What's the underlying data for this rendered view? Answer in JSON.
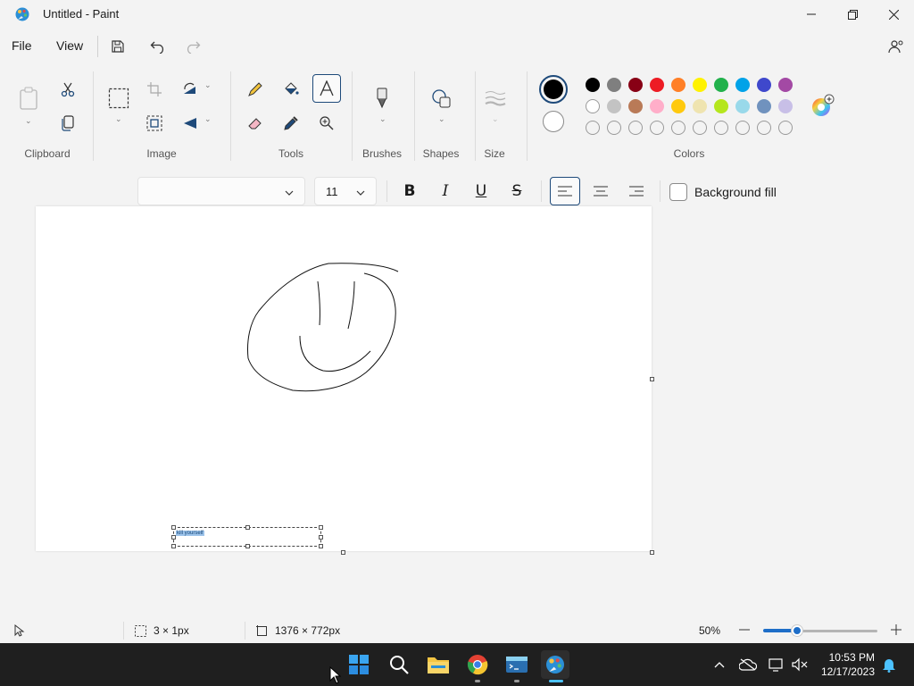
{
  "window": {
    "title": "Untitled - Paint"
  },
  "menu": {
    "file": "File",
    "view": "View"
  },
  "ribbon": {
    "groups": {
      "clipboard": "Clipboard",
      "image": "Image",
      "tools": "Tools",
      "brushes": "Brushes",
      "shapes": "Shapes",
      "size": "Size",
      "colors": "Colors"
    },
    "palette_row1": [
      "#000000",
      "#7f7f7f",
      "#880015",
      "#ed1c24",
      "#ff7f27",
      "#fff200",
      "#22b14c",
      "#00a2e8",
      "#3f48cc",
      "#a349a4"
    ],
    "palette_row2": [
      "#ffffff",
      "#c3c3c3",
      "#b97a57",
      "#ffaec9",
      "#ffc90e",
      "#efe4b0",
      "#b5e61d",
      "#99d9ea",
      "#7092be",
      "#c8bfe7"
    ],
    "palette_row3_count": 10,
    "primary_color": "#000000",
    "secondary_color": "#ffffff"
  },
  "text_toolbar": {
    "font_name": "",
    "font_size": "11",
    "bold_label": "B",
    "italic_label": "I",
    "underline_label": "U",
    "strike_label": "S",
    "background_fill": "Background fill"
  },
  "canvas": {
    "text_content": "kill yourself"
  },
  "status": {
    "selection_size": "3 × 1px",
    "canvas_size": "1376 × 772px",
    "zoom": "50%",
    "zoom_level": 0.3
  },
  "taskbar": {
    "time": "10:53 PM",
    "date": "12/17/2023"
  }
}
